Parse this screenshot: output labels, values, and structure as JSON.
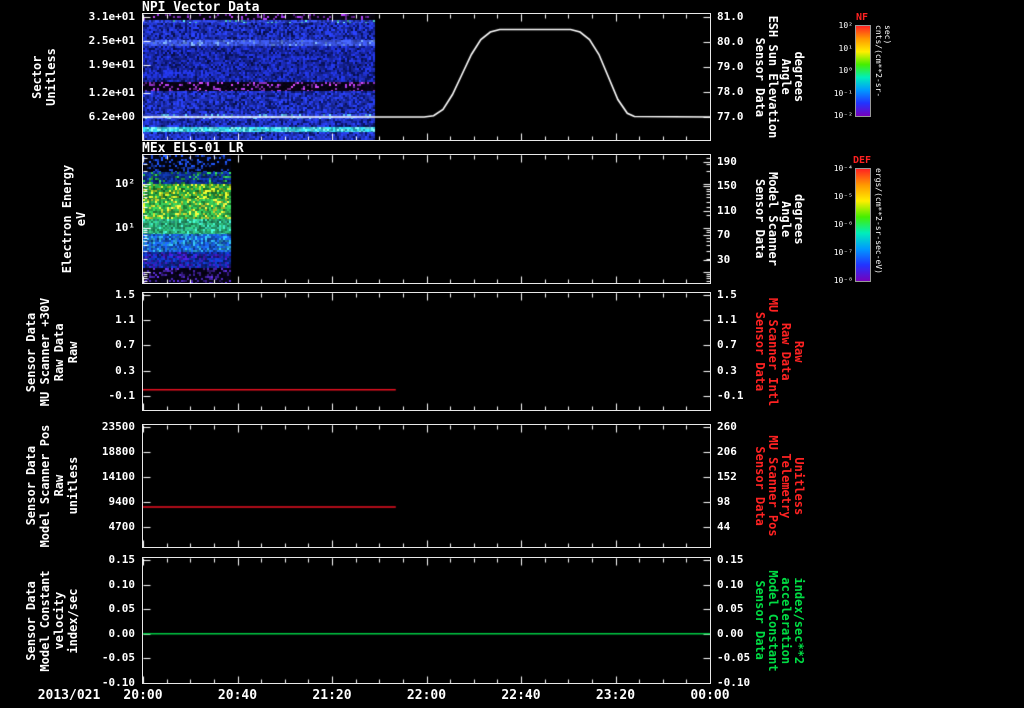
{
  "page": {
    "background": "#000000",
    "axis_color": "#ffffff"
  },
  "x_axis": {
    "date_label": "2013/021",
    "range_minutes": [
      0,
      240
    ],
    "minor_step": 10,
    "ticks": [
      {
        "t": 0,
        "label": "20:00"
      },
      {
        "t": 40,
        "label": "20:40"
      },
      {
        "t": 80,
        "label": "21:20"
      },
      {
        "t": 120,
        "label": "22:00"
      },
      {
        "t": 160,
        "label": "22:40"
      },
      {
        "t": 200,
        "label": "23:20"
      },
      {
        "t": 240,
        "label": "00:00"
      }
    ]
  },
  "colorbars": [
    {
      "name": "NF",
      "title": "NF",
      "title_color": "#ff2222",
      "unit": "cnts/(cm**2-sr-sec)",
      "tick_labels": [
        "10²",
        "10¹",
        "10⁰",
        "10⁻¹",
        "10⁻²"
      ],
      "gradient": [
        "#ff2222",
        "#ff9900",
        "#ffee00",
        "#44ee00",
        "#00eebb",
        "#0099ff",
        "#2233ff",
        "#7700bb"
      ]
    },
    {
      "name": "DEF",
      "title": "DEF",
      "title_color": "#ff2222",
      "unit": "ergs/(cm**2-sr-sec-eV)",
      "tick_labels": [
        "10⁻⁴",
        "10⁻⁵",
        "10⁻⁶",
        "10⁻⁷",
        "10⁻⁸"
      ],
      "gradient": [
        "#ff2222",
        "#ff9900",
        "#ffee00",
        "#44ee00",
        "#00eebb",
        "#0099ff",
        "#2233ff",
        "#7700bb"
      ]
    }
  ],
  "chart_data": [
    {
      "name": "npi-vector-data",
      "type": "spectrogram+line",
      "title": "NPI Vector Data",
      "left_axis": {
        "label_lines": [
          "Sector",
          "Unitless"
        ],
        "label_color": "#ffffff",
        "scale": "linear",
        "ylim": [
          0.4,
          31.75
        ],
        "ticks": [
          {
            "v": 31,
            "label": "3.1e+01"
          },
          {
            "v": 25,
            "label": "2.5e+01"
          },
          {
            "v": 19,
            "label": "1.9e+01"
          },
          {
            "v": 12,
            "label": "1.2e+01"
          },
          {
            "v": 6.2,
            "label": "6.2e+00"
          }
        ]
      },
      "right_axis": {
        "label_lines": [
          "Sensor Data",
          "ESH Sun Elevation",
          "Angle",
          "degrees"
        ],
        "label_color": "#ffffff",
        "scale": "linear",
        "ylim": [
          76.08,
          81.12
        ],
        "ticks": [
          {
            "v": 81,
            "label": "81.0"
          },
          {
            "v": 80,
            "label": "80.0"
          },
          {
            "v": 79,
            "label": "79.0"
          },
          {
            "v": 78,
            "label": "78.0"
          },
          {
            "v": 77,
            "label": "77.0"
          }
        ]
      },
      "series": [
        {
          "name": "esh-sun-elevation-angle",
          "axis": "right",
          "color": "#ffffff",
          "points": [
            [
              0,
              77
            ],
            [
              119,
              77
            ],
            [
              123,
              77.05
            ],
            [
              127,
              77.3
            ],
            [
              131,
              77.9
            ],
            [
              135,
              78.7
            ],
            [
              139,
              79.5
            ],
            [
              143,
              80.1
            ],
            [
              147,
              80.4
            ],
            [
              151,
              80.5
            ],
            [
              181,
              80.5
            ],
            [
              185,
              80.4
            ],
            [
              189,
              80.1
            ],
            [
              193,
              79.5
            ],
            [
              197,
              78.6
            ],
            [
              201,
              77.7
            ],
            [
              205,
              77.15
            ],
            [
              208,
              77.02
            ],
            [
              240,
              77
            ]
          ]
        }
      ],
      "spectrogram": {
        "t_range": [
          0,
          98
        ],
        "bands": [
          {
            "f0": 0.0,
            "f1": 0.045,
            "base": "#06040f",
            "speckle": "#8a35c8",
            "density": 0.16,
            "jitter": 0.5
          },
          {
            "f0": 0.045,
            "f1": 0.075,
            "base": "#2a3fd0",
            "speckle": "#52d8c8",
            "density": 0.1,
            "jitter": 0.4
          },
          {
            "f0": 0.075,
            "f1": 0.21,
            "base": "#2134c8",
            "speckle": "#0a1465",
            "density": 0.25,
            "jitter": 0.35
          },
          {
            "f0": 0.21,
            "f1": 0.255,
            "base": "#3b55e2",
            "speckle": "#6f9bff",
            "density": 0.15,
            "jitter": 0.3
          },
          {
            "f0": 0.255,
            "f1": 0.54,
            "base": "#1c2cba",
            "speckle": "#0a1465",
            "density": 0.25,
            "jitter": 0.35
          },
          {
            "f0": 0.54,
            "f1": 0.615,
            "base": "#080314",
            "speckle": "#9a35cf",
            "density": 0.2,
            "jitter": 0.5
          },
          {
            "f0": 0.615,
            "f1": 0.79,
            "base": "#2134c8",
            "speckle": "#0c1870",
            "density": 0.25,
            "jitter": 0.35
          },
          {
            "f0": 0.79,
            "f1": 0.83,
            "base": "#2c42d4",
            "speckle": "#58b8ea",
            "density": 0.18,
            "jitter": 0.3
          },
          {
            "f0": 0.83,
            "f1": 0.895,
            "base": "#2134c8",
            "speckle": "#0c1870",
            "density": 0.25,
            "jitter": 0.3
          },
          {
            "f0": 0.895,
            "f1": 0.935,
            "base": "#2fc0d8",
            "speckle": "#74eef8",
            "density": 0.3,
            "jitter": 0.3
          },
          {
            "f0": 0.935,
            "f1": 1.0,
            "base": "#2338cc",
            "speckle": "#0c1870",
            "density": 0.25,
            "jitter": 0.3
          }
        ]
      }
    },
    {
      "name": "mex-els-01-lr",
      "type": "spectrogram",
      "title": "MEx ELS-01 LR",
      "left_axis": {
        "label_lines": [
          "Electron Energy",
          "eV"
        ],
        "label_color": "#ffffff",
        "scale": "log",
        "ylim": [
          0.55,
          470
        ],
        "ticks": [
          {
            "v": 100,
            "label": "10²"
          },
          {
            "v": 10,
            "label": "10¹"
          }
        ]
      },
      "right_axis": {
        "label_lines": [
          "Sensor Data",
          "Model Scanner",
          "Angle",
          "degrees"
        ],
        "label_color": "#ffffff",
        "scale": "linear",
        "ylim": [
          -8,
          201
        ],
        "ticks": [
          {
            "v": 190,
            "label": "190"
          },
          {
            "v": 150,
            "label": "150"
          },
          {
            "v": 110,
            "label": "110"
          },
          {
            "v": 70,
            "label": "70"
          },
          {
            "v": 30,
            "label": "30"
          }
        ]
      },
      "series": [],
      "spectrogram": {
        "t_range": [
          0,
          37
        ],
        "bands": [
          {
            "f0": 0.0,
            "f1": 0.13,
            "base": "#03040f",
            "speckle": "#1840c0",
            "density": 0.28,
            "jitter": 0.5
          },
          {
            "f0": 0.13,
            "f1": 0.23,
            "base": "#0d2d8c",
            "speckle": "#28a848",
            "density": 0.22,
            "jitter": 0.45
          },
          {
            "f0": 0.23,
            "f1": 0.34,
            "base": "#23943c",
            "speckle": "#bcdc26",
            "density": 0.33,
            "jitter": 0.4
          },
          {
            "f0": 0.34,
            "f1": 0.5,
            "base": "#30b04c",
            "speckle": "#dcec36",
            "density": 0.28,
            "jitter": 0.35
          },
          {
            "f0": 0.5,
            "f1": 0.62,
            "base": "#28a26c",
            "speckle": "#38ccaa",
            "density": 0.3,
            "jitter": 0.35
          },
          {
            "f0": 0.62,
            "f1": 0.76,
            "base": "#1757cc",
            "speckle": "#2898cc",
            "density": 0.3,
            "jitter": 0.4
          },
          {
            "f0": 0.76,
            "f1": 0.88,
            "base": "#0e2da2",
            "speckle": "#3a18ac",
            "density": 0.3,
            "jitter": 0.45
          },
          {
            "f0": 0.88,
            "f1": 1.0,
            "base": "#070318",
            "speckle": "#4824ac",
            "density": 0.28,
            "jitter": 0.5
          }
        ]
      }
    },
    {
      "name": "mu-scanner-30v-raw",
      "type": "line",
      "title": "",
      "left_axis": {
        "label_lines": [
          "Sensor Data",
          "MU Scanner +30V",
          "Raw Data",
          "Raw"
        ],
        "label_color": "#ffffff",
        "scale": "linear",
        "ylim": [
          -0.32,
          1.53
        ],
        "ticks": [
          {
            "v": 1.5,
            "label": "1.5"
          },
          {
            "v": 1.1,
            "label": "1.1"
          },
          {
            "v": 0.7,
            "label": "0.7"
          },
          {
            "v": 0.3,
            "label": "0.3"
          },
          {
            "v": -0.1,
            "label": "-0.1"
          }
        ]
      },
      "right_axis": {
        "label_lines": [
          "Sensor Data",
          "MU Scanner Intl",
          "Raw Data",
          "Raw"
        ],
        "label_color": "#ff2222",
        "scale": "linear",
        "ylim": [
          -0.32,
          1.53
        ],
        "ticks": [
          {
            "v": 1.5,
            "label": "1.5"
          },
          {
            "v": 1.1,
            "label": "1.1"
          },
          {
            "v": 0.7,
            "label": "0.7"
          },
          {
            "v": 0.3,
            "label": "0.3"
          },
          {
            "v": -0.1,
            "label": "-0.1"
          }
        ]
      },
      "series": [
        {
          "name": "mu-scanner-30v-raw-line",
          "axis": "left",
          "color": "#ee1122",
          "points": [
            [
              0,
              0.0
            ],
            [
              107,
              0.0
            ]
          ]
        }
      ]
    },
    {
      "name": "model-scanner-pos-raw",
      "type": "line",
      "title": "",
      "left_axis": {
        "label_lines": [
          "Sensor Data",
          "Model Scanner Pos",
          "Raw",
          "unitless"
        ],
        "label_color": "#ffffff",
        "scale": "linear",
        "ylim": [
          940,
          23876
        ],
        "ticks": [
          {
            "v": 23500,
            "label": "23500"
          },
          {
            "v": 18800,
            "label": "18800"
          },
          {
            "v": 14100,
            "label": "14100"
          },
          {
            "v": 9400,
            "label": "9400"
          },
          {
            "v": 4700,
            "label": "4700"
          }
        ]
      },
      "right_axis": {
        "label_lines": [
          "Sensor Data",
          "MU Scanner Pos",
          "Telemetry",
          "Unitless"
        ],
        "label_color": "#ff2222",
        "scale": "linear",
        "ylim": [
          1,
          264.3
        ],
        "ticks": [
          {
            "v": 260,
            "label": "260"
          },
          {
            "v": 206,
            "label": "206"
          },
          {
            "v": 152,
            "label": "152"
          },
          {
            "v": 98,
            "label": "98"
          },
          {
            "v": 44,
            "label": "44"
          }
        ]
      },
      "series": [
        {
          "name": "model-scanner-pos-line",
          "axis": "left",
          "color": "#ee1122",
          "points": [
            [
              0,
              8460
            ],
            [
              107,
              8460
            ]
          ]
        }
      ]
    },
    {
      "name": "model-constant-velocity",
      "type": "line",
      "title": "",
      "left_axis": {
        "label_lines": [
          "Sensor Data",
          "Model Constant",
          "velocity",
          "index/sec"
        ],
        "label_color": "#ffffff",
        "scale": "linear",
        "ylim": [
          -0.1,
          0.154
        ],
        "ticks": [
          {
            "v": 0.15,
            "label": "0.15"
          },
          {
            "v": 0.1,
            "label": "0.10"
          },
          {
            "v": 0.05,
            "label": "0.05"
          },
          {
            "v": 0,
            "label": "0.00"
          },
          {
            "v": -0.05,
            "label": "-0.05"
          },
          {
            "v": -0.1,
            "label": "-0.10"
          }
        ]
      },
      "right_axis": {
        "label_lines": [
          "Sensor Data",
          "Model Constant",
          "acceleration",
          "index/sec**2"
        ],
        "label_color": "#00dd44",
        "scale": "linear",
        "ylim": [
          -0.1,
          0.154
        ],
        "ticks": [
          {
            "v": 0.15,
            "label": "0.15"
          },
          {
            "v": 0.1,
            "label": "0.10"
          },
          {
            "v": 0.05,
            "label": "0.05"
          },
          {
            "v": 0,
            "label": "0.00"
          },
          {
            "v": -0.05,
            "label": "-0.05"
          },
          {
            "v": -0.1,
            "label": "-0.10"
          }
        ]
      },
      "series": [
        {
          "name": "model-constant-velocity-line",
          "axis": "left",
          "color": "#00cc44",
          "points": [
            [
              0,
              0.0
            ],
            [
              240,
              0.0
            ]
          ]
        }
      ]
    }
  ]
}
